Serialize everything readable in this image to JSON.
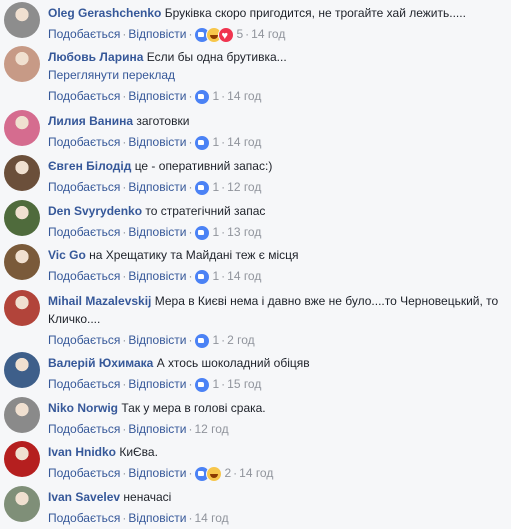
{
  "actions": {
    "like_label": "Подобається",
    "reply_label": "Відповісти",
    "separator": "·"
  },
  "comments": [
    {
      "author": "Oleg Gerashchenko",
      "text": "Бруківка скоро пригодится, не трогайте хай лежить.....",
      "reaction_count": "5",
      "reactions": [
        "like",
        "haha",
        "love"
      ],
      "time": "14 год",
      "avatar_color": "#8d8d8d"
    },
    {
      "author": "Любовь Ларина",
      "text": "Если бы одна брутивка...",
      "translate": "Переглянути переклад",
      "reaction_count": "1",
      "reactions": [
        "like"
      ],
      "time": "14 год",
      "avatar_color": "#c79a86"
    },
    {
      "author": "Лилия Ванина",
      "text": "заготовки",
      "reaction_count": "1",
      "reactions": [
        "like"
      ],
      "time": "14 год",
      "avatar_color": "#d56c8f"
    },
    {
      "author": "Євген Білодід",
      "text": "це - оперативний запас:)",
      "reaction_count": "1",
      "reactions": [
        "like"
      ],
      "time": "12 год",
      "avatar_color": "#6b4f3a"
    },
    {
      "author": "Den Svyrydenko",
      "text": "то стратегічний запас",
      "reaction_count": "1",
      "reactions": [
        "like"
      ],
      "time": "13 год",
      "avatar_color": "#4f6b3c"
    },
    {
      "author": "Vic Go",
      "text": "на Хрещатику та Майдані теж є місця",
      "reaction_count": "1",
      "reactions": [
        "like"
      ],
      "time": "14 год",
      "avatar_color": "#7a5a3a"
    },
    {
      "author": "Mihail Mazalevskij",
      "text": "Мера в Києві нема і давно вже не було....то Черновецький, то Кличко....",
      "reaction_count": "1",
      "reactions": [
        "like"
      ],
      "time": "2 год",
      "avatar_color": "#b2443a"
    },
    {
      "author": "Валерій Юхимака",
      "text": "А хтось шоколадний обіцяв",
      "reaction_count": "1",
      "reactions": [
        "like"
      ],
      "time": "15 год",
      "avatar_color": "#3e5f8a"
    },
    {
      "author": "Niko Norwig",
      "text": "Так у мера в голові срака.",
      "reaction_count": "",
      "reactions": [],
      "time": "12 год",
      "avatar_color": "#8a8a8a"
    },
    {
      "author": "Ivan Hnidko",
      "text": "КиЄва.",
      "reaction_count": "2",
      "reactions": [
        "like",
        "haha"
      ],
      "time": "14 год",
      "avatar_color": "#b51f1f"
    },
    {
      "author": "Ivan Savelev",
      "text": "неначасі",
      "reaction_count": "",
      "reactions": [],
      "time": "14 год",
      "avatar_color": "#7f8f78"
    }
  ]
}
